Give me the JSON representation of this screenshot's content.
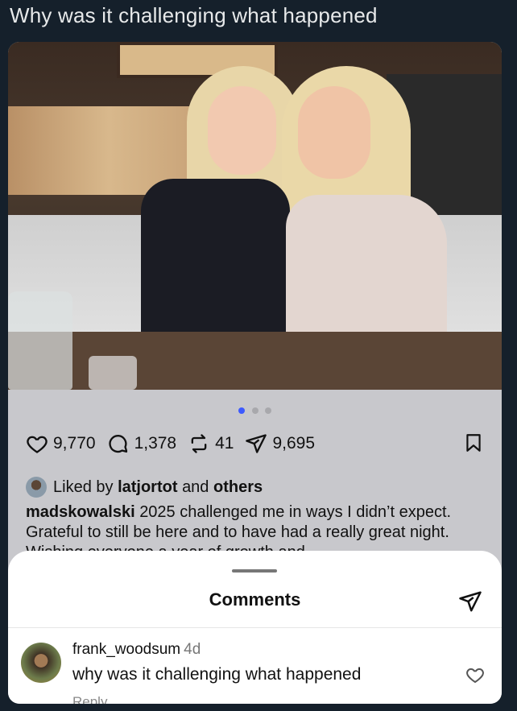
{
  "tweet": {
    "text": "Why was it challenging what happened"
  },
  "post": {
    "carousel": {
      "total": 3,
      "active": 1
    },
    "actions": {
      "likes": "9,770",
      "comments": "1,378",
      "reposts": "41",
      "shares": "9,695"
    },
    "liked_by": {
      "prefix": "Liked by",
      "user": "latjortot",
      "and": "and",
      "others": "others"
    },
    "caption": {
      "username": "madskowalski",
      "text": "2025 challenged me in ways I didn’t expect. Grateful to still be here and to have had a really great night. Wishing everyone a year of growth and"
    }
  },
  "comments_sheet": {
    "title": "Comments",
    "comment": {
      "username": "frank_woodsum",
      "time": "4d",
      "text": "why was it challenging what happened",
      "reply": "Reply"
    }
  },
  "colors": {
    "accent_dot": "#3d5afe",
    "background": "#15202b"
  }
}
